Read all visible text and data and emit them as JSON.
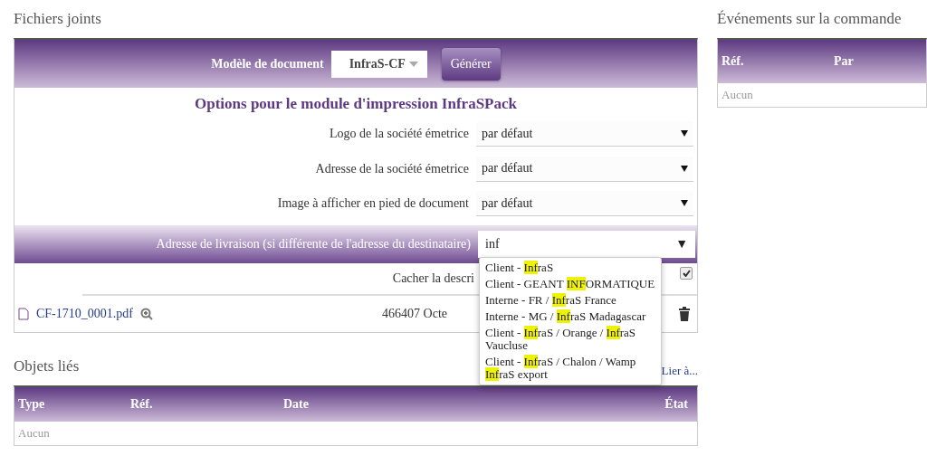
{
  "attachments": {
    "title": "Fichiers joints",
    "model": {
      "label": "Modèle de document",
      "value": "InfraS-CF",
      "button": "Générer"
    },
    "options_title": "Options pour le module d'impression InfraSPack",
    "options": [
      {
        "label": "Logo de la société émetrice",
        "value": "par défaut"
      },
      {
        "label": "Adresse de la société émetrice",
        "value": "par défaut"
      },
      {
        "label": "Image à afficher en pied de document",
        "value": "par défaut"
      }
    ],
    "delivery": {
      "label": "Adresse de livraison (si différente de l'adresse du destinataire)",
      "value": "inf",
      "caret": "▼",
      "suggestions": [
        "Client - **Inf**raS",
        "Client - GEANT **INF**ORMATIQUE",
        "Interne - FR / **Inf**raS France",
        "Interne - MG / **Inf**raS Madagascar",
        "Client - **Inf**raS / Orange / **Inf**raS Vaucluse",
        "Client - **Inf**raS / Chalon / Wamp **Inf**raS export"
      ]
    },
    "hide_description": {
      "label": "Cacher la descri",
      "checked": true
    },
    "files": [
      {
        "name": "CF-1710_0001.pdf",
        "size": "466407 Octe"
      }
    ]
  },
  "linked": {
    "title": "Objets liés",
    "link": "Lier à...",
    "columns": [
      "Type",
      "Réf.",
      "Date",
      "État"
    ],
    "empty": "Aucun"
  },
  "events": {
    "title": "Événements sur la commande",
    "columns": [
      "Réf.",
      "Par"
    ],
    "empty": "Aucun"
  }
}
